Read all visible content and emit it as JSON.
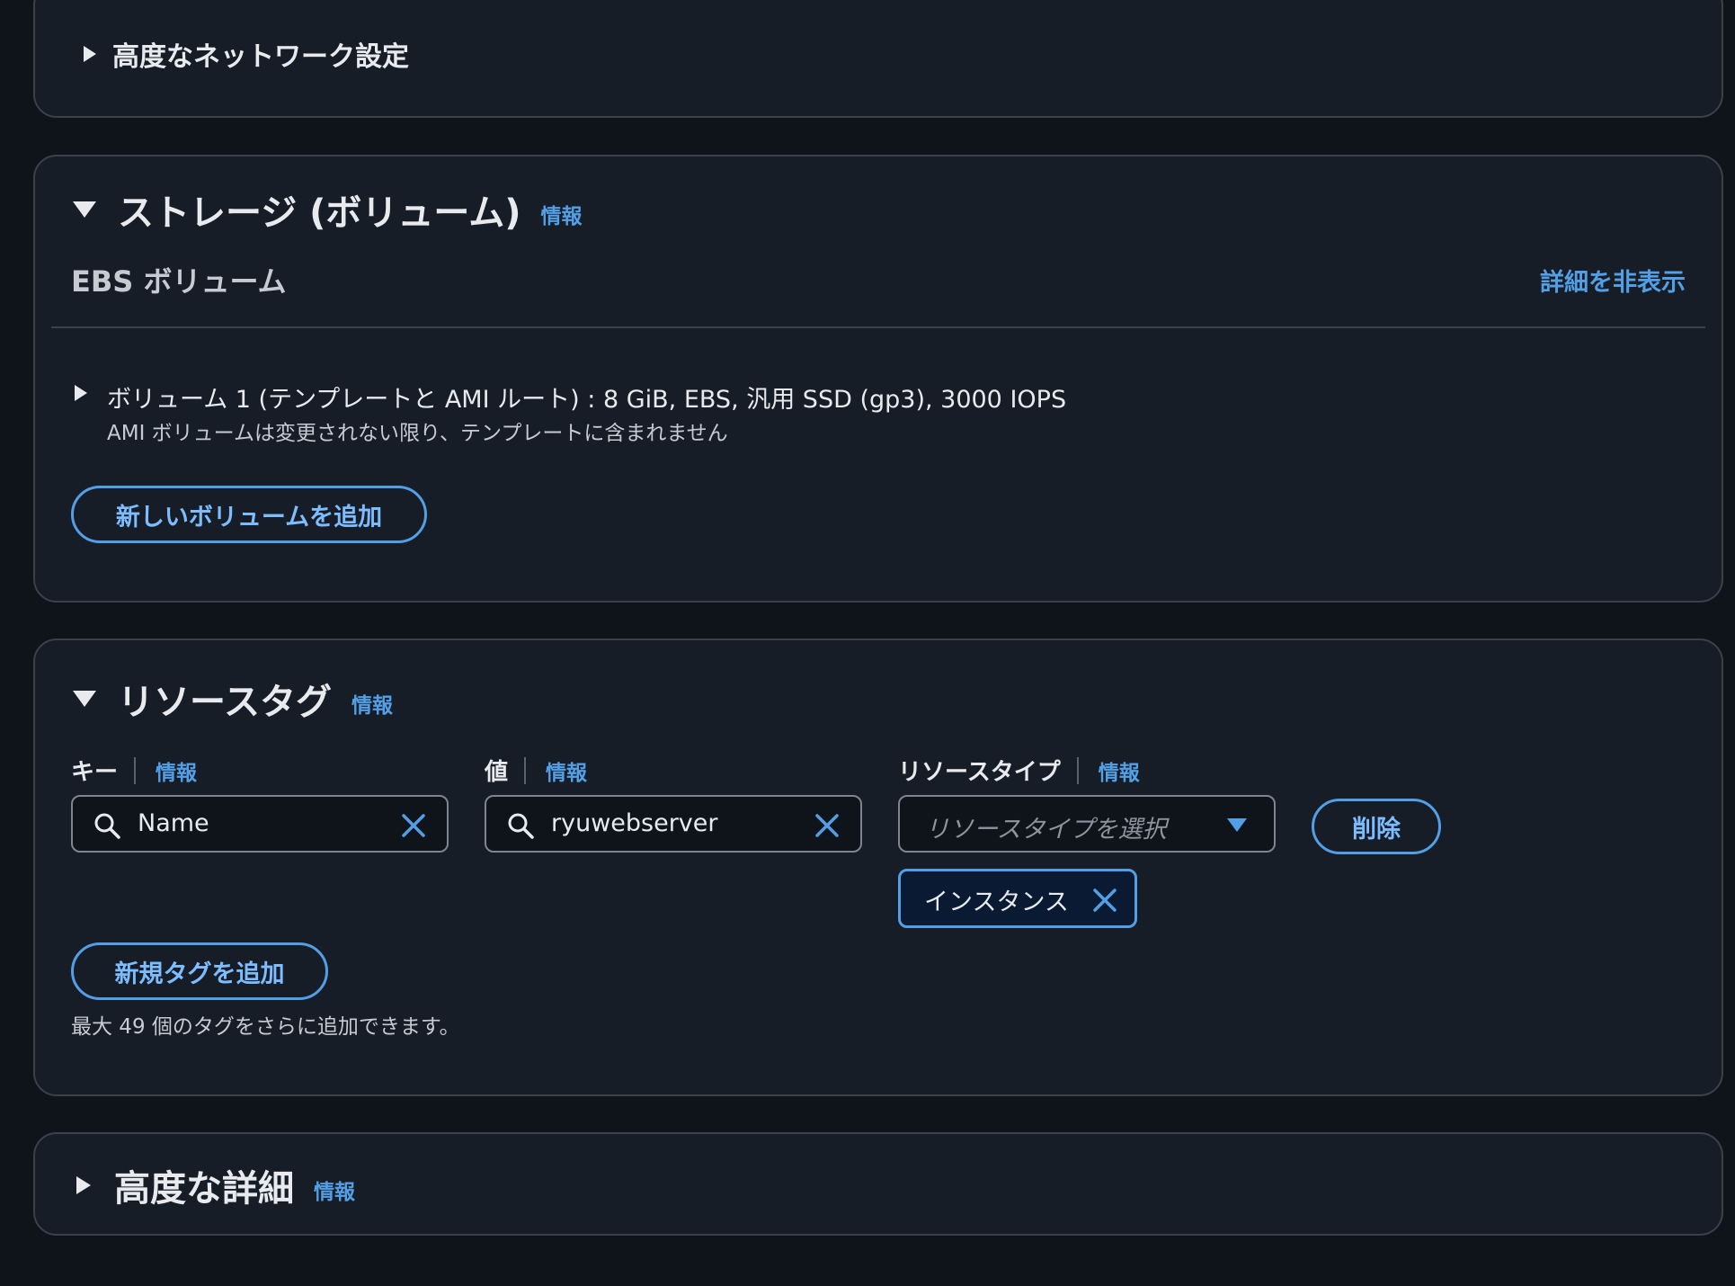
{
  "network": {
    "title": "高度なネットワーク設定"
  },
  "storage": {
    "title": "ストレージ (ボリューム)",
    "info": "情報",
    "ebs_label": "EBS ボリューム",
    "hide_details": "詳細を非表示",
    "volume_line": "ボリューム 1 (テンプレートと AMI ルート) : 8 GiB, EBS, 汎用 SSD (gp3), 3000 IOPS",
    "volume_note": "AMI ボリュームは変更されない限り、テンプレートに含まれません",
    "add_volume": "新しいボリュームを追加"
  },
  "tags": {
    "title": "リソースタグ",
    "info": "情報",
    "key_label": "キー",
    "key_info": "情報",
    "key_value": "Name",
    "value_label": "値",
    "value_info": "情報",
    "value_value": "ryuwebserver",
    "type_label": "リソースタイプ",
    "type_info": "情報",
    "type_placeholder": "リソースタイプを選択",
    "delete": "削除",
    "chip": "インスタンス",
    "add_tag": "新規タグを追加",
    "hint": "最大 49 個のタグをさらに追加できます。"
  },
  "advanced": {
    "title": "高度な詳細",
    "info": "情報"
  },
  "colors": {
    "background": "#0f141a",
    "panel": "#161d26",
    "border": "#3a414b",
    "link": "#539fe5",
    "chip_bg": "#0a1a33"
  },
  "icons": [
    "caret-right-icon",
    "caret-down-icon",
    "search-icon",
    "clear-icon",
    "dropdown-arrow-icon",
    "remove-chip-icon"
  ]
}
